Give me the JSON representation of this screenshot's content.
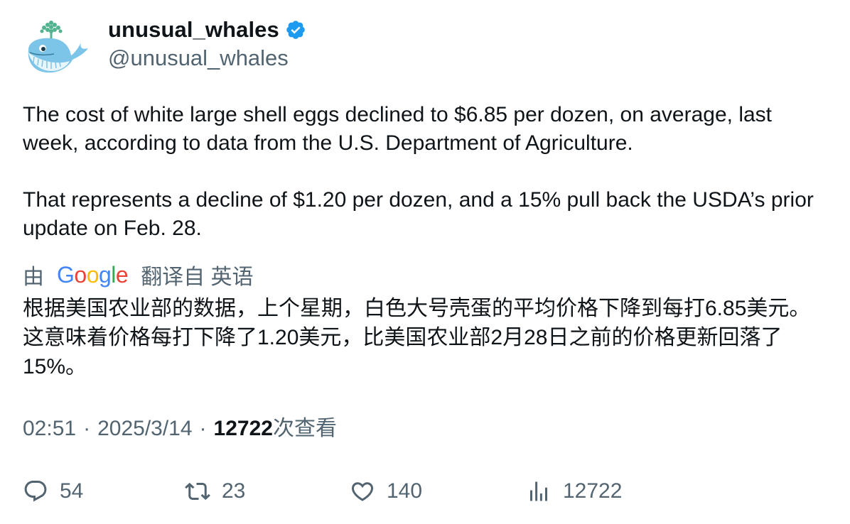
{
  "user": {
    "display_name": "unusual_whales",
    "handle": "@unusual_whales",
    "verified_icon": "verified-badge-icon",
    "avatar_icon": "whale-avatar-icon"
  },
  "tweet": {
    "paragraph_1": "The cost of white large shell eggs declined to $6.85 per dozen, on average, last week, according to data from the U.S. Department of Agriculture.",
    "paragraph_2": "That represents a decline of $1.20 per dozen, and a 15% pull back the USDA’s prior update on Feb. 28."
  },
  "translation": {
    "prefix": "由",
    "provider": "Google",
    "suffix": "翻译自 英语",
    "text": "根据美国农业部的数据，上个星期，白色大号壳蛋的平均价格下降到每打6.85美元。 这意味着价格每打下降了1.20美元，比美国农业部2月28日之前的价格更新回落了15%。"
  },
  "meta": {
    "time": "02:51",
    "separator": "·",
    "date": "2025/3/14",
    "views_count": "12722",
    "views_label": "次查看"
  },
  "actions": {
    "replies": "54",
    "retweets": "23",
    "likes": "140",
    "views": "12722"
  },
  "colors": {
    "text_primary": "#0f1419",
    "text_secondary": "#536471",
    "verified_blue": "#1d9bf0",
    "whale_blue": "#7cc4e8",
    "spout_green": "#52b38e"
  }
}
